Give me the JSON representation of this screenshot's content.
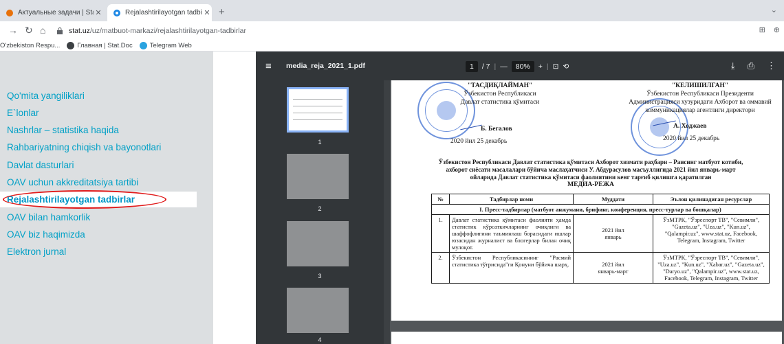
{
  "browser": {
    "tabs": [
      {
        "title": "Актуальные задачи | Stat.Doc",
        "active": false
      },
      {
        "title": "Rejalashtirilayotgan tadbirlar",
        "active": true
      }
    ],
    "new_tab": "+",
    "tab_close": "✕",
    "url_host": "stat.uz",
    "url_path": "/uz/matbuot-markazi/rejalashtirilayotgan-tadbirlar",
    "bookmarks": [
      "O'zbekiston Respu...",
      "Главная | Stat.Doc",
      "Telegram Web"
    ]
  },
  "left_nav": {
    "items": [
      "Qo'mita yangiliklari",
      "E`lonlar",
      "Nashrlar – statistika haqida",
      "Rahbariyatning chiqish va bayonotlari",
      "Davlat dasturlari",
      "OAV uchun akkreditatsiya tartibi",
      "Rejalashtirilayotgan tadbirlar",
      "OAV bilan hamkorlik",
      "OAV biz haqimizda",
      "Elektron jurnal"
    ],
    "active_index": 6
  },
  "pdf": {
    "file_name": "media_reja_2021_1.pdf",
    "page_current": "1",
    "page_total": "/ 7",
    "zoom": "80%",
    "zoom_minus": "—",
    "zoom_plus": "+",
    "thumbnails": [
      "1",
      "2",
      "3",
      "4"
    ]
  },
  "document": {
    "approve_left": {
      "heading": "\"ТАСДИҚЛАЙМАН\"",
      "line1": "Ўзбекистон Республикаси",
      "line2": "Давлат статистика қўмитаси",
      "signer": "Б. Бегалов",
      "date": "2020 йил  25 декабрь"
    },
    "approve_right": {
      "heading": "\"КЕЛИШИЛГАН\"",
      "line1": "Ўзбекистон Республикаси Президенти",
      "line2": "Администрацияси хузуридаги Ахборот ва оммавий",
      "line3": "коммуникациялар агентлиги директори",
      "signer": "А. Ходжаев",
      "date": "2020 йил  25 декабрь"
    },
    "title_line1": "Ўзбекистон Республикаси Давлат статистика қўмитаси Ахборот хизмати раҳбари – Раисинг матбуот котиби,",
    "title_line2": "ахборот сиёсати масалалари бўйича маслаҳатчиси У. Абдурасулов масъуллигида 2021 йил январь-март",
    "title_line3": "ойларида  Давлат статистика қўмитаси фаолиятини кенг тарғиб қилишга қаратилган",
    "plan_title": "МЕДИА-РЕЖА",
    "table": {
      "headers": [
        "№",
        "Тадбирлар номи",
        "Муддати",
        "Эълон қилинадиган ресурслар"
      ],
      "section": "I. Пресс-тадбирлар (матбуот анжумани, брифинг, конференция, пресс-турлар ва бошқалар)",
      "rows": [
        {
          "num": "1.",
          "name": "Давлат статистика қўмитаси фаолияти ҳамда статистик кўрсаткичларнинг очиқлиги ва шаффофлигини таъминлаш борасидаги ишлар юзасидан журналист ва блогерлар билан очиқ мулоқот.",
          "term1": "2021 йил",
          "term2": "январь",
          "resources": "ЎзМТРК, \"Ўзреспорт ТВ\", \"Севимли\", \"Gazeta.uz\", \"Uza.uz\", \"Kun.uz\", \"Qalampir.uz\", www.stat.uz, Facebook, Telegram, Instagram, Twitter"
        },
        {
          "num": "2.",
          "name": "Ўзбекистон Республикасининг \"Расмий статистика тўғрисида\"ги Қонуни бўйича шарҳ.",
          "term1": "2021 йил",
          "term2": "январь-март",
          "resources": "ЎзМТРК, \"Ўзреспорт ТВ\", \"Севимли\", \"Uza.uz\", \"Kun.uz\", \"Xabar.uz\", \"Gazeta.uz\", \"Daryo.uz\", \"Qalampir.uz\", www.stat.uz, Facebook, Telegram, Instagram, Twitter"
        }
      ]
    }
  },
  "colors": {
    "nav_link": "#00a0c6",
    "nav_bg": "#dcdfe1",
    "highlight": "#e01b1b",
    "pdf_toolbar": "#323639",
    "stamp": "#3f6fd1"
  }
}
